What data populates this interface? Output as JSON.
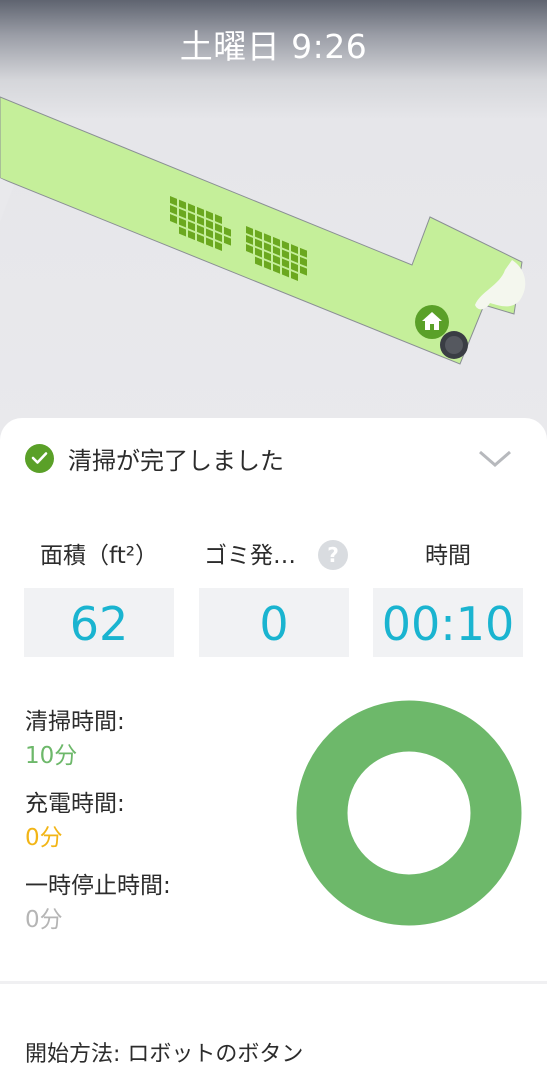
{
  "header": {
    "title": "土曜日 9:26"
  },
  "map": {
    "area_color": "#c5ef9a",
    "dock_icon": "home-icon",
    "robot_icon": "robot-icon"
  },
  "summary": {
    "status_text": "清掃が完了しました",
    "status_icon": "check-circle-icon",
    "collapse_icon": "chevron-down-icon"
  },
  "stats": [
    {
      "label": "面積（ft²）",
      "value": "62"
    },
    {
      "label": "ゴミ発…",
      "value": "0"
    },
    {
      "label": "時間",
      "value": "00:10"
    }
  ],
  "help_icon_text": "?",
  "breakdown": {
    "cleaning_label": "清掃時間:",
    "cleaning_value": "10分",
    "cleaning_color": "#6db86a",
    "charging_label": "充電時間:",
    "charging_value": "0分",
    "charging_color": "#f2b516",
    "paused_label": "一時停止時間:",
    "paused_value": "0分",
    "paused_color": "#b5b5b5"
  },
  "footer": {
    "start_method": "開始方法: ロボットのボタン"
  }
}
